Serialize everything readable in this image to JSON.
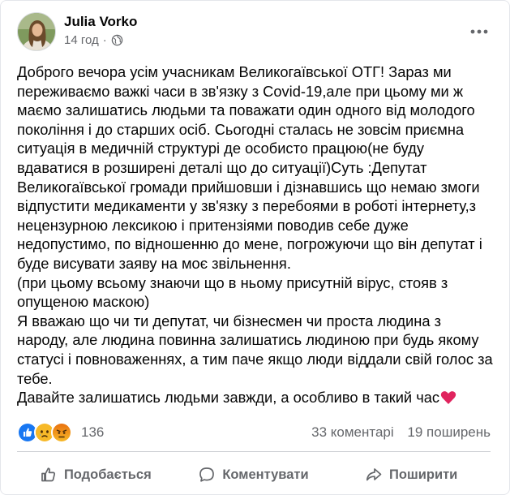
{
  "post": {
    "author": "Julia Vorko",
    "time": "14 год",
    "privacy_icon": "globe-icon",
    "paragraphs": [
      "Доброго вечора усім учасникам Великогаївської ОТГ! Зараз ми переживаємо важкі часи в зв'язку з Covid-19,але при цьому ми ж маємо залишатись людьми та поважати один одного від молодого покоління і до старших осіб. Сьогодні сталась не зовсім приємна ситуація в медичній структурі де особисто працюю(не буду вдаватися в розширені деталі що до ситуації)Суть :Депутат Великогаївської громади прийшовши і дізнавшись що немаю змоги відпустити медикаменти у зв'язку з перебоями в роботі інтернету,з нецензурною лексикою і притензіями поводив себе дуже недопустимо, по відношенню до мене, погрожуючи що він депутат і буде висувати заяву на моє звільнення.",
      "(при цьому всьому знаючи що в ньому присутній вірус, стояв з опущеною маскою)",
      "Я вважаю що чи ти депутат, чи бізнесмен чи проста людина з народу, але людина повинна залишатись людиною при будь якому статусі і повноваженнях, а тим паче якщо люди віддали свій голос за тебе.",
      "Давайте залишатись людьми завжди, а особливо в такий час"
    ]
  },
  "stats": {
    "reactions": [
      "like",
      "sad",
      "angry"
    ],
    "reaction_count": "136",
    "comments": "33 коментарі",
    "shares": "19 поширень"
  },
  "actions": {
    "like": "Подобається",
    "comment": "Коментувати",
    "share": "Поширити"
  },
  "colors": {
    "like_blue": "#1877f2",
    "sad_yellow": "#f7b928",
    "angry_orange": "#e9710f",
    "heart_red": "#e0245e",
    "muted_text": "#65676b"
  }
}
